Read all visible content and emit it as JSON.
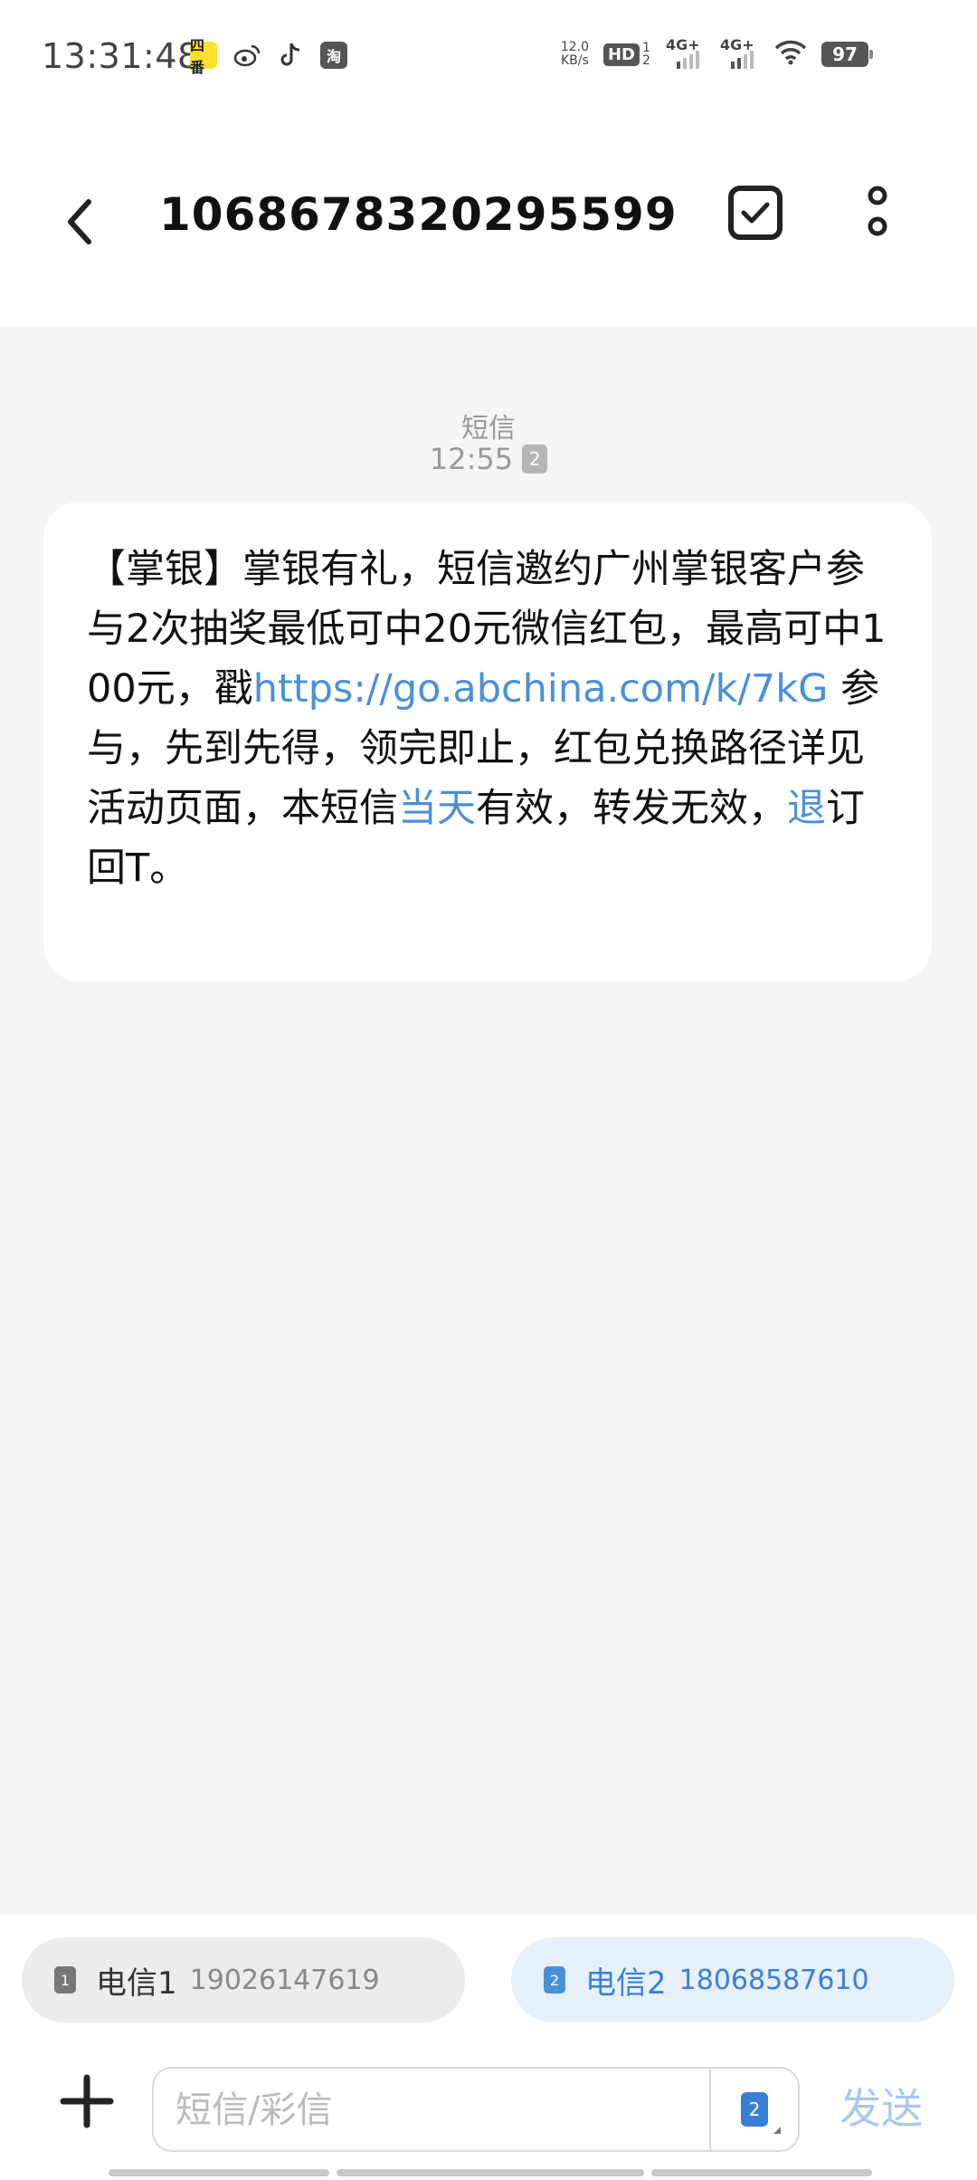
{
  "status_bar": {
    "time": "13:31:48",
    "app_icons": [
      "yellow-app-icon",
      "weibo-icon",
      "tiktok-icon",
      "taobao-icon"
    ],
    "yellow_app_label": "四番",
    "taobao_label": "淘",
    "net_speed_value": "12.0",
    "net_speed_unit": "KB/s",
    "hd_label": "HD",
    "hd_sub": "1 2",
    "signal_1": "4G+",
    "signal_2": "4G+",
    "battery": "97"
  },
  "header": {
    "title": "1068678320295599"
  },
  "message": {
    "type_label": "短信",
    "time": "12:55",
    "sim_slot": "2",
    "text_part_1": "【掌银】掌银有礼，短信邀约广州掌银客户参与2次抽奖最低可中20元微信红包，最高可中100元，戳",
    "link": "https://go.abchina.com/k/7kG",
    "text_part_2": " 参与，先到先得，领完即止，红包兑换路径详见活动页面，本短信",
    "highlight_1": "当天",
    "text_part_3": "有效，转发无效，",
    "highlight_2": "退",
    "text_part_4": "订回T。"
  },
  "sim_selector": {
    "sim1": {
      "slot": "1",
      "name": "电信1",
      "number": "19026147619"
    },
    "sim2": {
      "slot": "2",
      "name": "电信2",
      "number": "18068587610"
    }
  },
  "composer": {
    "placeholder": "短信/彩信",
    "sim_slot": "2",
    "send_label": "发送"
  },
  "colors": {
    "link": "#4a90d9",
    "accent": "#3a7fd6",
    "background": "#f5f5f5"
  }
}
